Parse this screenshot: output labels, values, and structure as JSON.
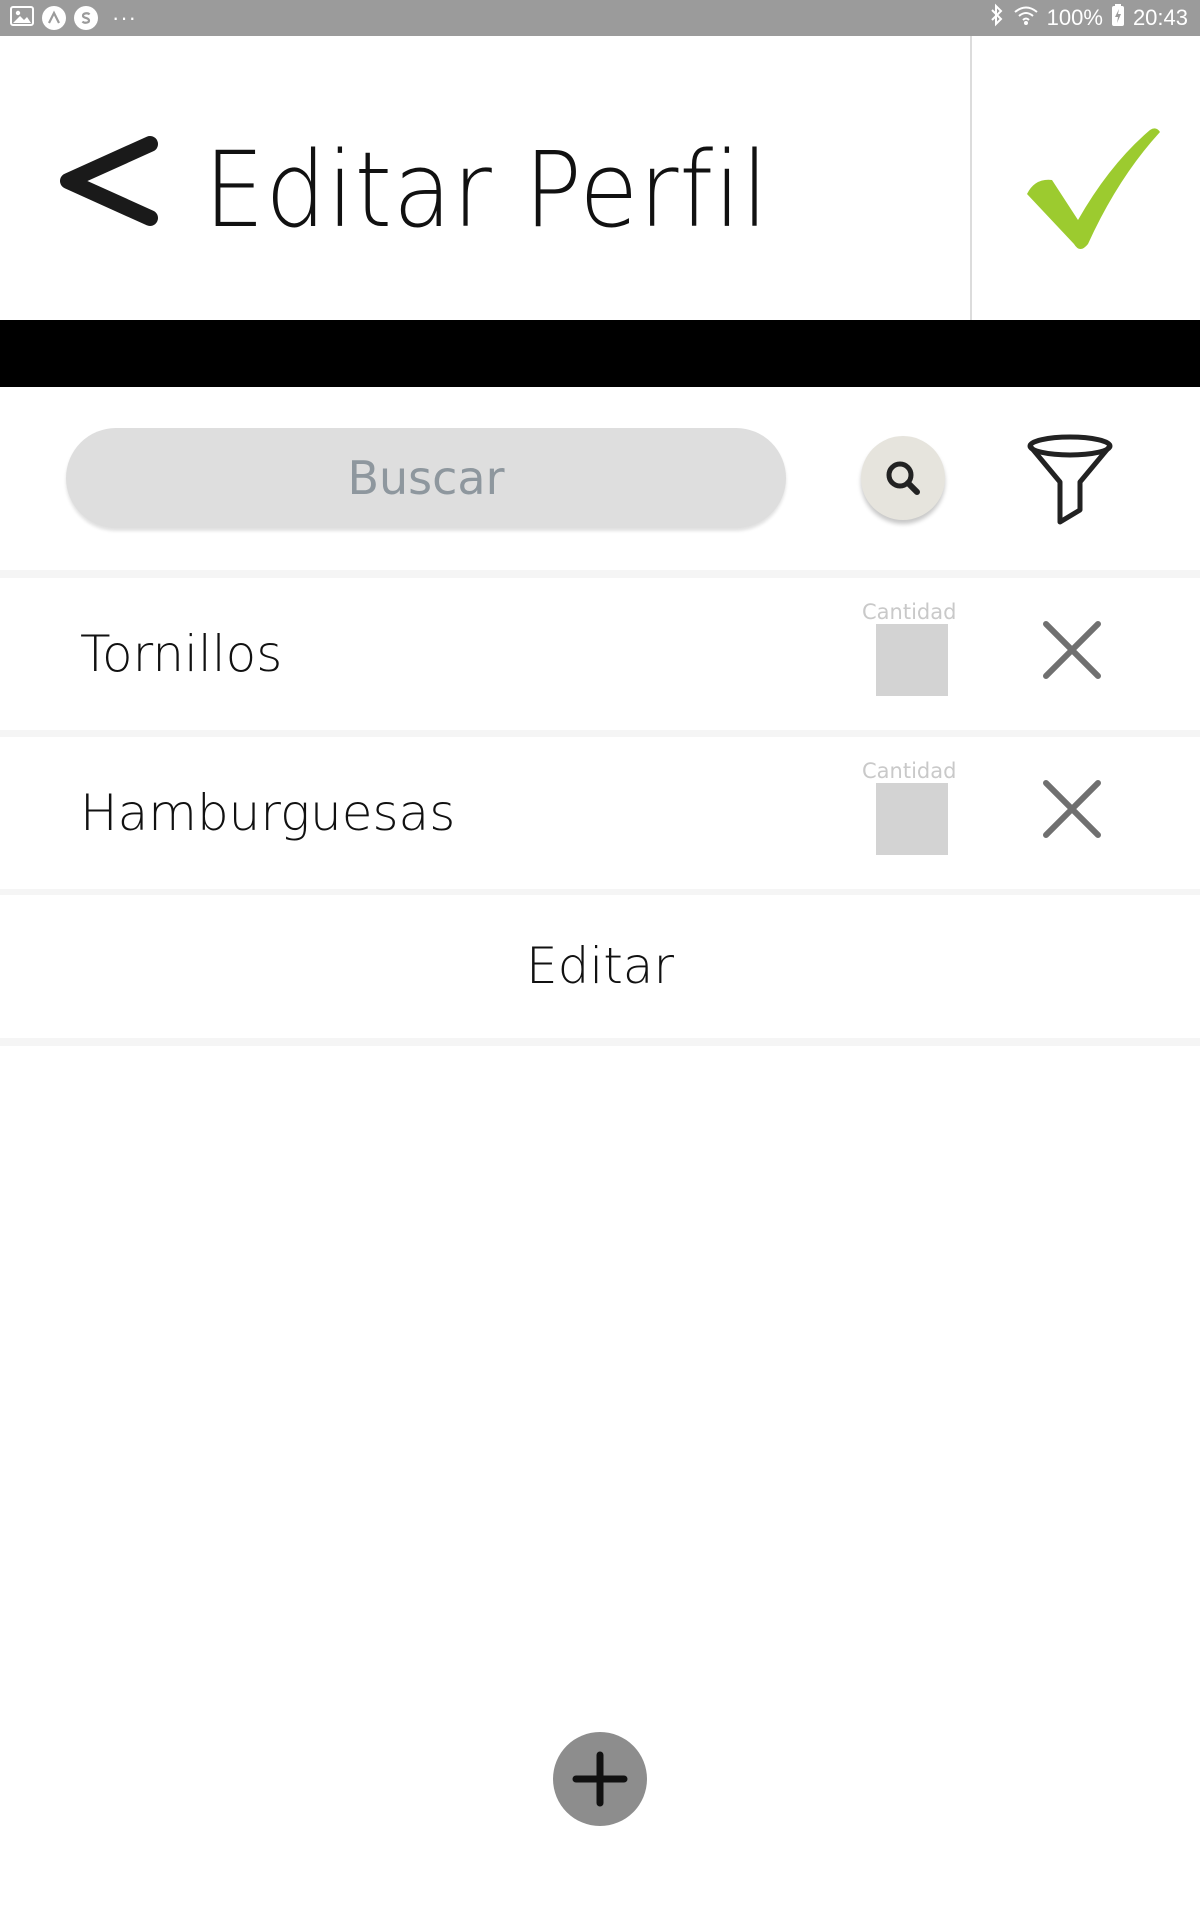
{
  "status_bar": {
    "notification_icons": [
      "gallery-icon",
      "app-a-icon",
      "app-s-icon"
    ],
    "more_indicator": "···",
    "battery": "100%",
    "time": "20:43"
  },
  "header": {
    "title": "Editar Perfil",
    "back_icon": "chevron-left-icon",
    "confirm_icon": "checkmark-icon"
  },
  "search": {
    "placeholder": "Buscar",
    "value": ""
  },
  "items": [
    {
      "name": "Tornillos",
      "quantity_label": "Cantidad",
      "quantity_value": ""
    },
    {
      "name": "Hamburguesas",
      "quantity_label": "Cantidad",
      "quantity_value": ""
    }
  ],
  "edit_label": "Editar",
  "add_icon": "plus-icon",
  "colors": {
    "status_bar": "#9b9b9b",
    "accent_green": "#9ccb2f",
    "search_bg": "#dedede",
    "qty_box": "#d3d3d3",
    "fab": "#8d8d8d"
  }
}
